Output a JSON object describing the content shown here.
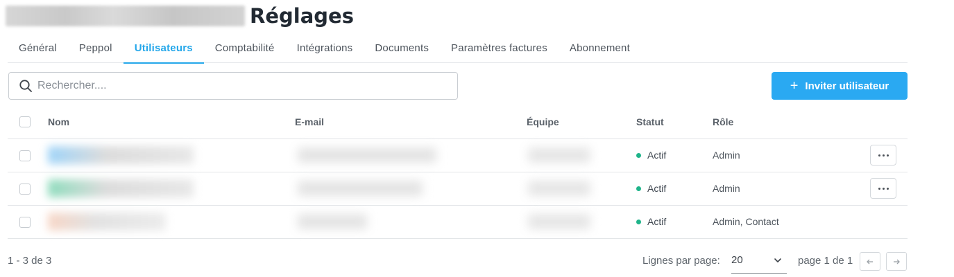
{
  "header": {
    "title": "Réglages"
  },
  "tabs": [
    {
      "label": "Général"
    },
    {
      "label": "Peppol"
    },
    {
      "label": "Utilisateurs",
      "active": true
    },
    {
      "label": "Comptabilité"
    },
    {
      "label": "Intégrations"
    },
    {
      "label": "Documents"
    },
    {
      "label": "Paramètres factures"
    },
    {
      "label": "Abonnement"
    }
  ],
  "search": {
    "placeholder": "Rechercher...."
  },
  "invite_button": {
    "label": "Inviter utilisateur",
    "icon": "plus-icon"
  },
  "table": {
    "columns": [
      "Nom",
      "E-mail",
      "Équipe",
      "Statut",
      "Rôle"
    ],
    "rows": [
      {
        "status": "Actif",
        "role": "Admin",
        "has_menu": true
      },
      {
        "status": "Actif",
        "role": "Admin",
        "has_menu": true
      },
      {
        "status": "Actif",
        "role": "Admin, Contact",
        "has_menu": false
      }
    ]
  },
  "pagination": {
    "range": "1 - 3 de 3",
    "rows_per_page_label": "Lignes par page:",
    "rows_per_page_value": "20",
    "page_info": "page 1 de 1"
  },
  "colors": {
    "accent": "#24a7ea",
    "button": "#2aa9f2",
    "status_active": "#1fb48a"
  }
}
